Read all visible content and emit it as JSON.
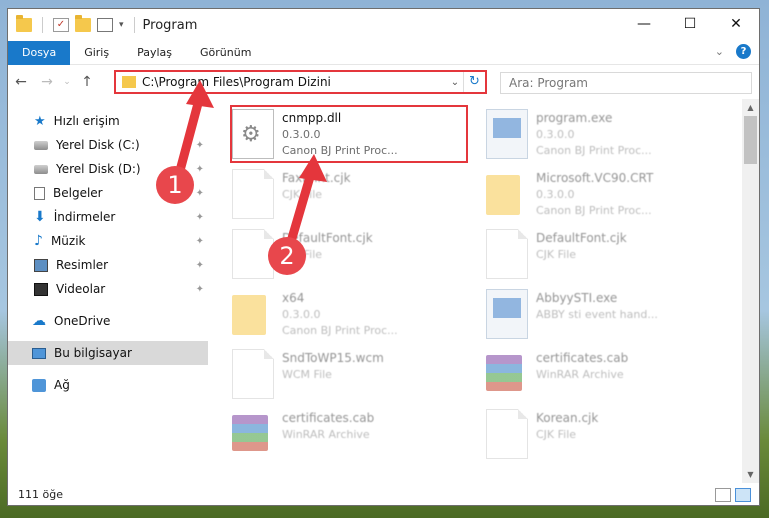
{
  "window": {
    "title": "Program",
    "controls": {
      "minimize": "—",
      "maximize": "☐",
      "close": "✕"
    }
  },
  "ribbon": {
    "tabs": [
      "Dosya",
      "Giriş",
      "Paylaş",
      "Görünüm"
    ],
    "expand": "⌄",
    "help": "?"
  },
  "nav": {
    "back": "←",
    "forward": "→",
    "recent": "⌄",
    "up": "↑"
  },
  "address": {
    "path": "C:\\Program Files\\Program Dizini",
    "dropdown": "⌄",
    "refresh": "↻"
  },
  "search": {
    "placeholder": "Ara: Program"
  },
  "sidebar": {
    "items": [
      {
        "label": "Hızlı erişim",
        "icon": "star-icon"
      },
      {
        "label": "Yerel Disk (C:)",
        "icon": "disk-icon"
      },
      {
        "label": "Yerel Disk (D:)",
        "icon": "disk-icon"
      },
      {
        "label": "Belgeler",
        "icon": "documents-icon"
      },
      {
        "label": "İndirmeler",
        "icon": "download-icon"
      },
      {
        "label": "Müzik",
        "icon": "music-icon"
      },
      {
        "label": "Resimler",
        "icon": "pictures-icon"
      },
      {
        "label": "Videolar",
        "icon": "video-icon"
      },
      {
        "label": "OneDrive",
        "icon": "cloud-icon"
      },
      {
        "label": "Bu bilgisayar",
        "icon": "computer-icon"
      },
      {
        "label": "Ağ",
        "icon": "network-icon"
      }
    ],
    "pin": "📌"
  },
  "files": [
    {
      "name": "cnmpp.dll",
      "line1": "0.3.0.0",
      "line2": "Canon BJ Print Proc..."
    },
    {
      "name": "program.exe",
      "line1": "0.3.0.0",
      "line2": "Canon BJ Print Proc..."
    },
    {
      "name": "FaxPrint.cjk",
      "line1": "CJK File",
      "line2": ""
    },
    {
      "name": "Microsoft.VC90.CRT",
      "line1": "0.3.0.0",
      "line2": "Canon BJ Print Proc..."
    },
    {
      "name": "DefaultFont.cjk",
      "line1": "CJK File",
      "line2": ""
    },
    {
      "name": "DefaultFont.cjk",
      "line1": "CJK File",
      "line2": ""
    },
    {
      "name": "x64",
      "line1": "0.3.0.0",
      "line2": "Canon BJ Print Proc..."
    },
    {
      "name": "AbbyySTI.exe",
      "line1": "ABBY sti event hand...",
      "line2": ""
    },
    {
      "name": "SndToWP15.wcm",
      "line1": "WCM File",
      "line2": ""
    },
    {
      "name": "certificates.cab",
      "line1": "WinRAR Archive",
      "line2": ""
    },
    {
      "name": "certificates.cab",
      "line1": "WinRAR Archive",
      "line2": ""
    },
    {
      "name": "Korean.cjk",
      "line1": "CJK File",
      "line2": ""
    }
  ],
  "status": {
    "count": "111 öğe"
  },
  "annotations": {
    "step1": "1",
    "step2": "2",
    "color": "#e4363c"
  }
}
